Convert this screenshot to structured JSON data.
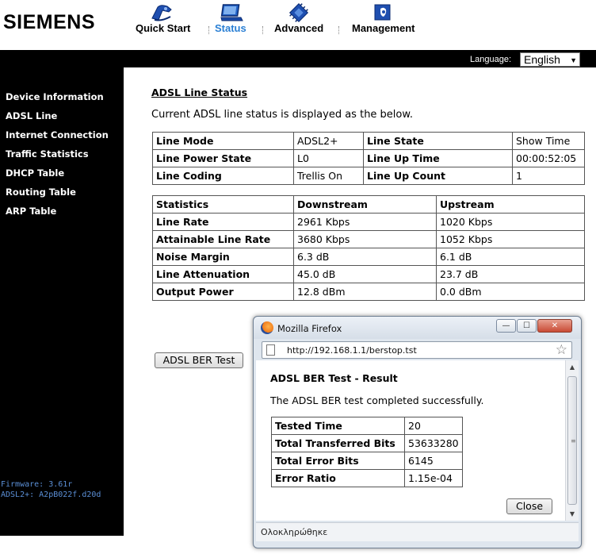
{
  "brand": {
    "logo": "SIEMENS"
  },
  "nav": [
    {
      "label": "Quick Start",
      "icon": "quick-start-icon"
    },
    {
      "label": "Status",
      "icon": "status-icon",
      "active": true
    },
    {
      "label": "Advanced",
      "icon": "advanced-icon"
    },
    {
      "label": "Management",
      "icon": "management-icon"
    }
  ],
  "colors": {
    "nav_active": "#2a7fd4",
    "sidebar_bg": "#000000",
    "firmware_text": "#5b8fd6"
  },
  "language": {
    "label": "Language:",
    "selected": "English"
  },
  "sidebar": {
    "items": [
      {
        "label": "Device Information"
      },
      {
        "label": "ADSL Line"
      },
      {
        "label": "Internet Connection"
      },
      {
        "label": "Traffic Statistics"
      },
      {
        "label": "DHCP Table"
      },
      {
        "label": "Routing Table"
      },
      {
        "label": "ARP Table"
      }
    ],
    "firmware": "Firmware: 3.61r",
    "adsl_version": "ADSL2+: A2pB022f.d20d"
  },
  "main": {
    "title": "ADSL Line Status",
    "description": "Current ADSL line status is displayed as the below.",
    "status_table": [
      [
        "Line Mode",
        "ADSL2+",
        "Line State",
        "Show Time"
      ],
      [
        "Line Power State",
        "L0",
        "Line Up Time",
        "00:00:52:05"
      ],
      [
        "Line Coding",
        "Trellis On",
        "Line Up Count",
        "1"
      ]
    ],
    "stats_table": {
      "headers": [
        "Statistics",
        "Downstream",
        "Upstream"
      ],
      "rows": [
        [
          "Line Rate",
          "2961 Kbps",
          "1020 Kbps"
        ],
        [
          "Attainable Line Rate",
          "3680 Kbps",
          "1052 Kbps"
        ],
        [
          "Noise Margin",
          "6.3 dB",
          "6.1 dB"
        ],
        [
          "Line Attenuation",
          "45.0 dB",
          "23.7 dB"
        ],
        [
          "Output Power",
          "12.8 dBm",
          "0.0 dBm"
        ]
      ]
    },
    "ber_button": "ADSL BER Test"
  },
  "popup": {
    "window_title": "Mozilla Firefox",
    "url": "http://192.168.1.1/berstop.tst",
    "result_title": "ADSL BER Test - Result",
    "result_desc": "The ADSL BER test completed successfully.",
    "results": [
      [
        "Tested Time",
        "20"
      ],
      [
        "Total Transferred Bits",
        "53633280"
      ],
      [
        "Total Error Bits",
        "6145"
      ],
      [
        "Error Ratio",
        "1.15e-04"
      ]
    ],
    "close_button": "Close",
    "status": "Ολοκληρώθηκε"
  }
}
